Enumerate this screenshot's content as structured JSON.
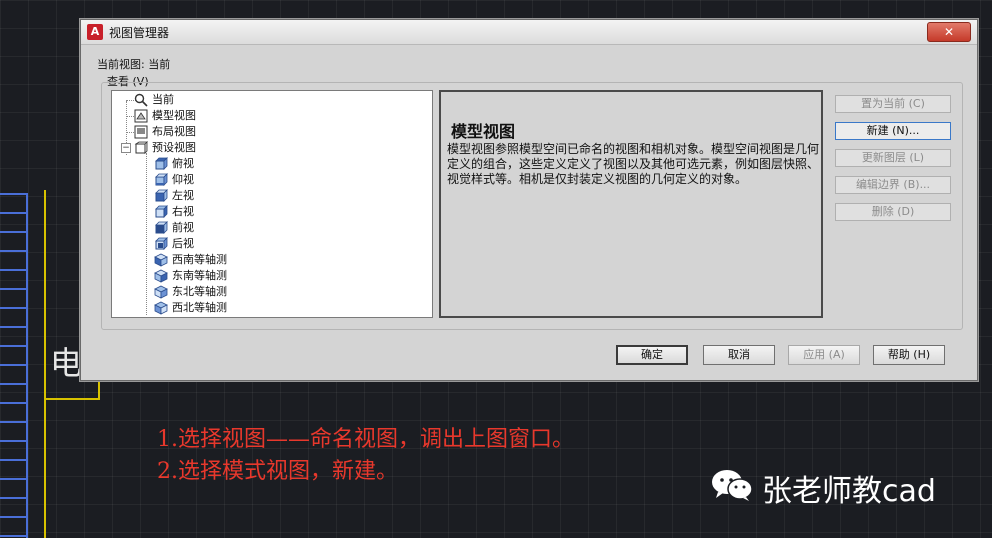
{
  "background": {
    "cad_text": "电"
  },
  "dialog": {
    "title": "视图管理器",
    "close_label": "✕",
    "current_view_label": "当前视图: 当前",
    "view_group_label": "查看 (V)",
    "tree": [
      {
        "label": "当前",
        "icon": "magnifier-icon"
      },
      {
        "label": "模型视图",
        "icon": "model-view-icon"
      },
      {
        "label": "布局视图",
        "icon": "layout-view-icon"
      },
      {
        "label": "预设视图",
        "icon": "preset-view-icon"
      },
      {
        "label": "俯视",
        "icon": "cube-top-icon"
      },
      {
        "label": "仰视",
        "icon": "cube-bottom-icon"
      },
      {
        "label": "左视",
        "icon": "cube-left-icon"
      },
      {
        "label": "右视",
        "icon": "cube-right-icon"
      },
      {
        "label": "前视",
        "icon": "cube-front-icon"
      },
      {
        "label": "后视",
        "icon": "cube-back-icon"
      },
      {
        "label": "西南等轴测",
        "icon": "iso-sw-icon"
      },
      {
        "label": "东南等轴测",
        "icon": "iso-se-icon"
      },
      {
        "label": "东北等轴测",
        "icon": "iso-ne-icon"
      },
      {
        "label": "西北等轴测",
        "icon": "iso-nw-icon"
      }
    ],
    "info": {
      "title": "模型视图",
      "description": "模型视图参照模型空间已命名的视图和相机对象。模型空间视图是几何定义的组合，这些定义定义了视图以及其他可选元素，例如图层快照、视觉样式等。相机是仅封装定义视图的几何定义的对象。"
    },
    "side_buttons": {
      "set_current": "置为当前 (C)",
      "new": "新建 (N)...",
      "update_layers": "更新图层 (L)",
      "edit_boundaries": "编辑边界 (B)...",
      "delete": "删除 (D)"
    },
    "bottom_buttons": {
      "ok": "确定",
      "cancel": "取消",
      "apply": "应用 (A)",
      "help": "帮助 (H)"
    }
  },
  "annotations": {
    "line1": "1.选择视图——命名视图，调出上图窗口。",
    "line2": "2.选择模式视图，新建。",
    "watermark": "张老师教cad"
  },
  "colors": {
    "annotation": "#e8382c",
    "accent": "#3a78c8",
    "cad_yellow": "#d8c200",
    "cad_blue": "#4a6fd8"
  }
}
